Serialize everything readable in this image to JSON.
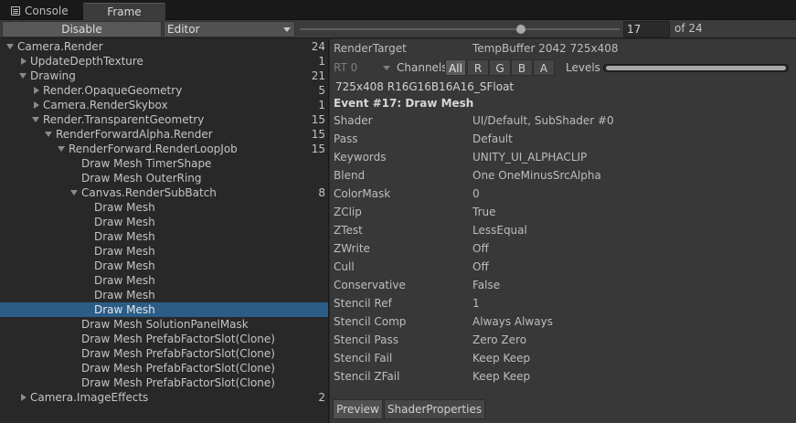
{
  "tabs": {
    "console": "Console",
    "frame_debug": "Frame Debug"
  },
  "toolbar": {
    "disable_label": "Disable",
    "target": "Editor",
    "current_event": "17",
    "of_label": "of 24",
    "event_total": 24
  },
  "tree": [
    {
      "label": "Camera.Render",
      "count": "24",
      "depth": 0,
      "arrow": "down"
    },
    {
      "label": "UpdateDepthTexture",
      "count": "1",
      "depth": 1,
      "arrow": "right"
    },
    {
      "label": "Drawing",
      "count": "21",
      "depth": 1,
      "arrow": "down"
    },
    {
      "label": "Render.OpaqueGeometry",
      "count": "5",
      "depth": 2,
      "arrow": "right"
    },
    {
      "label": "Camera.RenderSkybox",
      "count": "1",
      "depth": 2,
      "arrow": "right"
    },
    {
      "label": "Render.TransparentGeometry",
      "count": "15",
      "depth": 2,
      "arrow": "down"
    },
    {
      "label": "RenderForwardAlpha.Render",
      "count": "15",
      "depth": 3,
      "arrow": "down"
    },
    {
      "label": "RenderForward.RenderLoopJob",
      "count": "15",
      "depth": 4,
      "arrow": "down"
    },
    {
      "label": "Draw Mesh TimerShape",
      "count": "",
      "depth": 5,
      "arrow": ""
    },
    {
      "label": "Draw Mesh OuterRing",
      "count": "",
      "depth": 5,
      "arrow": ""
    },
    {
      "label": "Canvas.RenderSubBatch",
      "count": "8",
      "depth": 5,
      "arrow": "down"
    },
    {
      "label": "Draw Mesh",
      "count": "",
      "depth": 6,
      "arrow": ""
    },
    {
      "label": "Draw Mesh",
      "count": "",
      "depth": 6,
      "arrow": ""
    },
    {
      "label": "Draw Mesh",
      "count": "",
      "depth": 6,
      "arrow": ""
    },
    {
      "label": "Draw Mesh",
      "count": "",
      "depth": 6,
      "arrow": ""
    },
    {
      "label": "Draw Mesh",
      "count": "",
      "depth": 6,
      "arrow": ""
    },
    {
      "label": "Draw Mesh",
      "count": "",
      "depth": 6,
      "arrow": ""
    },
    {
      "label": "Draw Mesh",
      "count": "",
      "depth": 6,
      "arrow": ""
    },
    {
      "label": "Draw Mesh",
      "count": "",
      "depth": 6,
      "arrow": "",
      "selected": true
    },
    {
      "label": "Draw Mesh SolutionPanelMask",
      "count": "",
      "depth": 5,
      "arrow": ""
    },
    {
      "label": "Draw Mesh PrefabFactorSlot(Clone)",
      "count": "",
      "depth": 5,
      "arrow": ""
    },
    {
      "label": "Draw Mesh PrefabFactorSlot(Clone)",
      "count": "",
      "depth": 5,
      "arrow": ""
    },
    {
      "label": "Draw Mesh PrefabFactorSlot(Clone)",
      "count": "",
      "depth": 5,
      "arrow": ""
    },
    {
      "label": "Draw Mesh PrefabFactorSlot(Clone)",
      "count": "",
      "depth": 5,
      "arrow": ""
    },
    {
      "label": "Camera.ImageEffects",
      "count": "2",
      "depth": 1,
      "arrow": "right"
    }
  ],
  "detail": {
    "render_target_label": "RenderTarget",
    "render_target_value": "TempBuffer 2042 725x408",
    "rt_select": "RT 0",
    "channels_label": "Channels",
    "channels": [
      "All",
      "R",
      "G",
      "B",
      "A"
    ],
    "active_channel": "All",
    "levels_label": "Levels",
    "levels_range": [
      0.0,
      1.0
    ],
    "format": "725x408 R16G16B16A16_SFloat",
    "event_title": "Event #17: Draw Mesh",
    "properties": [
      {
        "key": "Shader",
        "value": "UI/Default, SubShader #0"
      },
      {
        "key": "Pass",
        "value": "Default"
      },
      {
        "key": "Keywords",
        "value": "UNITY_UI_ALPHACLIP"
      },
      {
        "key": "Blend",
        "value": "One OneMinusSrcAlpha"
      },
      {
        "key": "ColorMask",
        "value": "0"
      },
      {
        "key": "ZClip",
        "value": "True"
      },
      {
        "key": "ZTest",
        "value": "LessEqual"
      },
      {
        "key": "ZWrite",
        "value": "Off"
      },
      {
        "key": "Cull",
        "value": "Off"
      },
      {
        "key": "Conservative",
        "value": "False"
      },
      {
        "key": "Stencil Ref",
        "value": "1"
      },
      {
        "key": "Stencil Comp",
        "value": "Always Always"
      },
      {
        "key": "Stencil Pass",
        "value": "Zero Zero"
      },
      {
        "key": "Stencil Fail",
        "value": "Keep Keep"
      },
      {
        "key": "Stencil ZFail",
        "value": "Keep Keep"
      }
    ],
    "bottom_tabs": [
      "Preview",
      "ShaderProperties"
    ]
  },
  "colors": {
    "selection": "#2c5d87",
    "panel": "#383838",
    "tree_bg": "#282828"
  }
}
